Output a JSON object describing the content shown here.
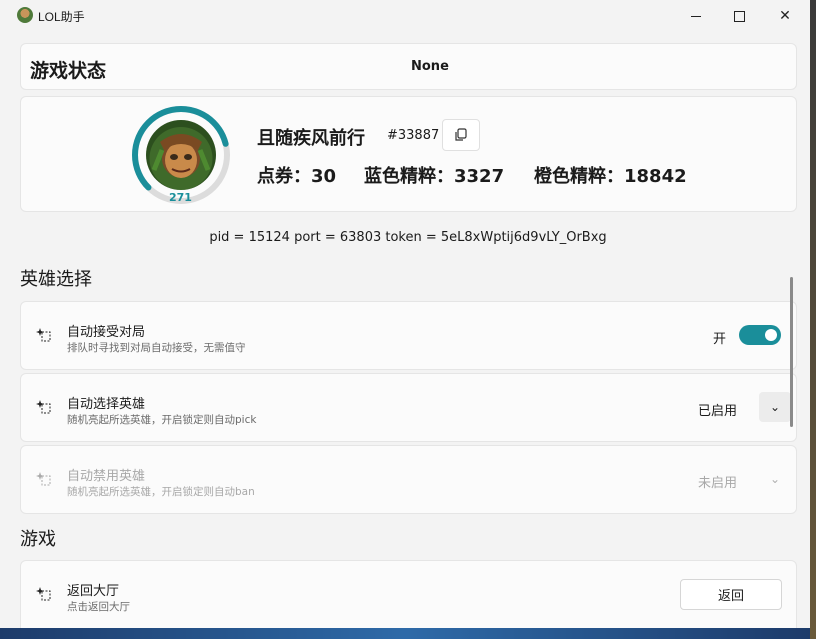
{
  "window": {
    "title": "LOL助手"
  },
  "status": {
    "title": "游戏状态",
    "value": "None"
  },
  "profile": {
    "level": "271",
    "level_progress": 0.78,
    "name": "且随疾风前行",
    "tag": "#33887",
    "stats": [
      {
        "label": "点券：",
        "value": "30"
      },
      {
        "label": "蓝色精粹：",
        "value": "3327"
      },
      {
        "label": "橙色精粹：",
        "value": "18842"
      }
    ]
  },
  "connection": "pid = 15124 port = 63803 token = 5eL8xWptij6d9vLY_OrBxg",
  "sections": {
    "champ_select": "英雄选择",
    "game": "游戏"
  },
  "settings": {
    "auto_accept": {
      "title": "自动接受对局",
      "desc": "排队时寻找到对局自动接受，无需值守",
      "value": "开",
      "on": true
    },
    "auto_pick": {
      "title": "自动选择英雄",
      "desc": "随机亮起所选英雄，开启锁定则自动pick",
      "value": "已启用"
    },
    "auto_ban": {
      "title": "自动禁用英雄",
      "desc": "随机亮起所选英雄，开启锁定则自动ban",
      "value": "未启用"
    },
    "back_lobby": {
      "title": "返回大厅",
      "desc": "点击返回大厅",
      "button": "返回"
    }
  },
  "colors": {
    "accent": "#1a8e9a"
  }
}
